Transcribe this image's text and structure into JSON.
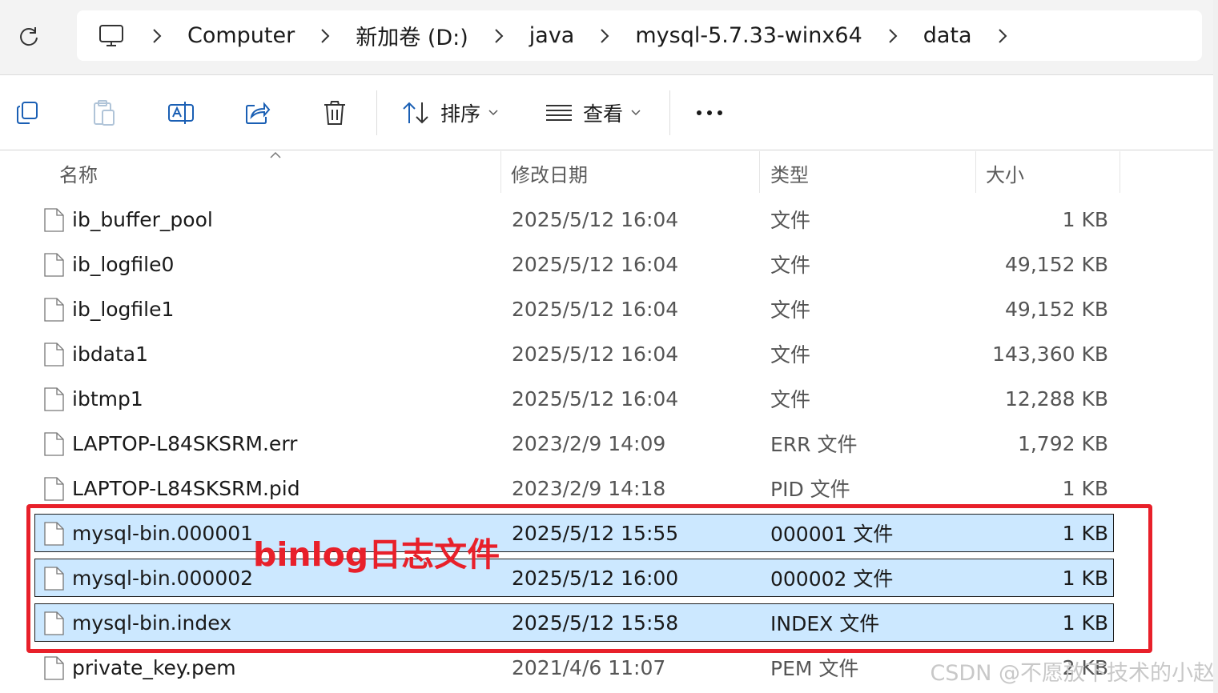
{
  "address_bar": {
    "breadcrumbs": [
      "Computer",
      "新加卷 (D:)",
      "java",
      "mysql-5.7.33-winx64",
      "data"
    ]
  },
  "command_bar": {
    "sort_label": "排序",
    "view_label": "查看",
    "more_label": "•••"
  },
  "columns": {
    "name": "名称",
    "date": "修改日期",
    "type": "类型",
    "size": "大小"
  },
  "files": [
    {
      "name": "ib_buffer_pool",
      "date": "2025/5/12 16:04",
      "type": "文件",
      "size": "1 KB",
      "selected": false
    },
    {
      "name": "ib_logfile0",
      "date": "2025/5/12 16:04",
      "type": "文件",
      "size": "49,152 KB",
      "selected": false
    },
    {
      "name": "ib_logfile1",
      "date": "2025/5/12 16:04",
      "type": "文件",
      "size": "49,152 KB",
      "selected": false
    },
    {
      "name": "ibdata1",
      "date": "2025/5/12 16:04",
      "type": "文件",
      "size": "143,360 KB",
      "selected": false
    },
    {
      "name": "ibtmp1",
      "date": "2025/5/12 16:04",
      "type": "文件",
      "size": "12,288 KB",
      "selected": false
    },
    {
      "name": "LAPTOP-L84SKSRM.err",
      "date": "2023/2/9 14:09",
      "type": "ERR 文件",
      "size": "1,792 KB",
      "selected": false
    },
    {
      "name": "LAPTOP-L84SKSRM.pid",
      "date": "2023/2/9 14:18",
      "type": "PID 文件",
      "size": "1 KB",
      "selected": false
    },
    {
      "name": "mysql-bin.000001",
      "date": "2025/5/12 15:55",
      "type": "000001 文件",
      "size": "1 KB",
      "selected": true
    },
    {
      "name": "mysql-bin.000002",
      "date": "2025/5/12 16:00",
      "type": "000002 文件",
      "size": "1 KB",
      "selected": true
    },
    {
      "name": "mysql-bin.index",
      "date": "2025/5/12 15:58",
      "type": "INDEX 文件",
      "size": "1 KB",
      "selected": true
    },
    {
      "name": "private_key.pem",
      "date": "2021/4/6 11:07",
      "type": "PEM 文件",
      "size": "2 KB",
      "selected": false
    }
  ],
  "annotation": {
    "label": "binlog日志文件",
    "color": "#e8202a"
  },
  "watermark": "CSDN @不愿放下技术的小赵",
  "colors": {
    "selection_bg": "#cce8ff",
    "annotation_red": "#e8202a"
  }
}
